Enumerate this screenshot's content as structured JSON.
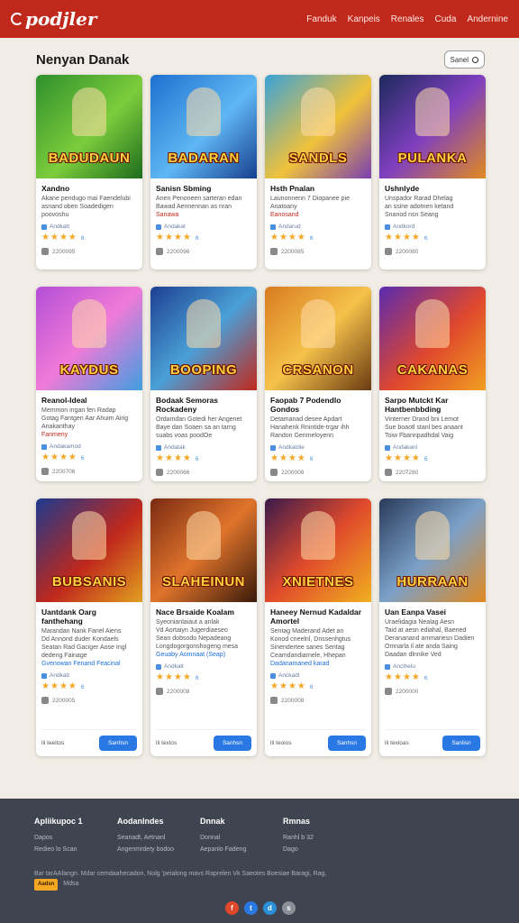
{
  "header": {
    "logo": "podjler",
    "nav": [
      "Fanduk",
      "Kanpeis",
      "Renales",
      "Cuda",
      "Andernine"
    ]
  },
  "section": {
    "title": "Nenyan Danak",
    "search_label": "Sanel"
  },
  "colors": {
    "primary": "#c0281c",
    "button": "#2a78e4",
    "star": "#f5a623",
    "footer": "#3f4550"
  },
  "cards": [
    {
      "art": "BADUDAUN",
      "bg": "linear-gradient(135deg,#2e8f2c,#7ccd3c 55%,#1d6b1d)",
      "title": "Xandno",
      "desc": [
        "Akane pendugo mai Faendelubi",
        "asnand oben Soadedigen",
        "poovoshu"
      ],
      "desc_hl": "",
      "tag": "Andkatt",
      "rating": "6",
      "date": "2200095",
      "fill": 4
    },
    {
      "art": "BADARAN",
      "bg": "linear-gradient(135deg,#1f6fd0,#5fb7f2 55%,#163f8f)",
      "title": "Sanisn Sbming",
      "desc": [
        "Anen Penoneen sarteran edan",
        "Bawad Aennennan as nran"
      ],
      "desc_hl": "Sanawa",
      "tag": "Andakat",
      "rating": "6",
      "date": "2200096",
      "fill": 4
    },
    {
      "art": "SANDLS",
      "bg": "linear-gradient(135deg,#3aa2d8,#f0c23a 55%,#7a3fb0)",
      "title": "Hsth Pnalan",
      "desc": [
        "Launonnenn 7 Diopanee pie",
        "Anatoany"
      ],
      "desc_hl": "Eanosand",
      "tag": "Andarud",
      "rating": "6",
      "date": "2200085",
      "fill": 4
    },
    {
      "art": "PULANKA",
      "bg": "linear-gradient(135deg,#1b2a5a,#7f3fc0 50%,#e08a20)",
      "title": "Ushnlyde",
      "desc": [
        "Unspador Rarad Dhelag",
        "an ssine adotnen ketand",
        "Snanod nsn Seang"
      ],
      "desc_hl": "",
      "tag": "Andkord",
      "rating": "6",
      "date": "2200080",
      "fill": 4
    },
    {
      "art": "KAYDUS",
      "bg": "linear-gradient(135deg,#b34fd8,#f07ad8 50%,#3f9ee0)",
      "title": "Reanol-Ideal",
      "desc": [
        "Memmon ingan fen Radap",
        "Gotag Fantgen Aar Ahuim Airig",
        "Anakanthay"
      ],
      "desc_hl": "Fanmeny",
      "tag": "Andakamod",
      "rating": "6",
      "date": "2200706",
      "fill": 4
    },
    {
      "art": "BOOPING",
      "bg": "linear-gradient(135deg,#1d3f8f,#4aa0d8 50%,#c0281c)",
      "title": "Bodaak Semoras Rockadeny",
      "desc": [
        "Ordamdan Gotedi her Angenet",
        "Baye dan Soaen sa an tarng",
        "suabs voas poodOe"
      ],
      "desc_hl": "",
      "tag": "Andatak",
      "rating": "6",
      "date": "2200066",
      "fill": 4
    },
    {
      "art": "CRSANON",
      "bg": "linear-gradient(135deg,#d87a20,#f5c24a 50%,#6a3a12)",
      "title": "Faopab 7 Podendlo Gondos",
      "desc": [
        "Detamanad desee Apdart",
        "Hanahenk Rnintide-trgar ihh",
        "Randon Genmeloyenn"
      ],
      "desc_hl": "",
      "tag": "Andkatdie",
      "rating": "6",
      "date": "2200008",
      "fill": 4
    },
    {
      "art": "CAKANAS",
      "bg": "linear-gradient(135deg,#5a2bb0,#e0482c 55%,#f0a020)",
      "title": "Sarpo Mutckt Kar Hantbenbbding",
      "desc": [
        "Vinterner Drand bni Lemot",
        "Sue boaotl stanl bes anaant",
        "Toiw Fbannpadhdal Vaig"
      ],
      "desc_hl": "",
      "tag": "Andakani",
      "rating": "6",
      "date": "2207280",
      "fill": 4
    },
    {
      "art": "BUBSANIS",
      "bg": "linear-gradient(135deg,#1d3a8f,#c0281c 55%,#e0a020)",
      "title": "Uantdank Oarg fanthehang",
      "desc": [
        "Marandan Nank Fanel Aiens",
        "Dd Annond duder Kondaels",
        "Seatan Rad Gaciger Aose Ingl",
        "dedeng Fainage"
      ],
      "desc_hl": "Gvenowan Fenand Feacinal",
      "tag": "Andkatt",
      "rating": "6",
      "date": "2200005",
      "fill": 4
    },
    {
      "art": "SLAHEINUN",
      "bg": "linear-gradient(135deg,#7a2a12,#e0742c 50%,#3a1a0a)",
      "title": "Nace Brsaide Koalam",
      "desc": [
        "Syeonianlaiaut a anlak",
        "Vd Aortaiyn Jugerdiaeseo",
        "Sean dobsodo Nepadeang",
        "Longdogorgonshogeng mesa"
      ],
      "desc_hl": "Geuaby Aomnaat (Seap)",
      "tag": "Andkalt",
      "rating": "6",
      "date": "2200008",
      "fill": 4
    },
    {
      "art": "XNIETNES",
      "bg": "linear-gradient(135deg,#3a1a4a,#e04a2c 50%,#f0b020)",
      "title": "Haneey Nernud Kadaldar Amortel",
      "desc": [
        "Sentag Maderand Adet an",
        "Konod cneelnl, Dnssenhgtus",
        "Sinendertee sanes Sentag",
        "Ceamdandiarnele, Hhepan"
      ],
      "desc_hl": "Dadanamaned karad",
      "tag": "Anckadt",
      "rating": "6",
      "date": "2200008",
      "fill": 4
    },
    {
      "art": "HURRAAN",
      "bg": "linear-gradient(135deg,#2a3a5a,#7aa0c8 50%,#e08a20)",
      "title": "Uan Eanpa Vasei",
      "desc": [
        "Uraelidagia Nealag Aesn",
        "Taid at aesn ediahal, Baened",
        "Derananand ammariesn Dadien",
        "Omnarla il ate anda Saing",
        "Daadan dlnnike Ved"
      ],
      "desc_hl": "",
      "tag": "Anclhelu",
      "rating": "6",
      "date": "2200000",
      "fill": 4
    }
  ],
  "row3_footer": {
    "label": "lli texlos",
    "button": "Sanhsn"
  },
  "row3_footer_labels": [
    "lli teeitos",
    "lli texlos",
    "lli teoios",
    "lli texloas"
  ],
  "row3_footer_buttons": [
    "Sanhsn",
    "Sanhsn",
    "Sanhsn",
    "Sanlisn"
  ],
  "footer": {
    "cols": [
      {
        "title": "Apliikupoc 1",
        "items": [
          "Dapos",
          "Redieo lo Scan"
        ]
      },
      {
        "title": "Aodanlndes",
        "items": [
          "Seanadt, Aetnanl",
          "Angenmrdety bodoo"
        ]
      },
      {
        "title": "Dnnak",
        "items": [
          "Donnal",
          "Aepanlo Fadeng"
        ]
      },
      {
        "title": "Rmnas",
        "items": [
          "Ranhl b 32",
          "Dago"
        ]
      }
    ],
    "note": "Bar tarAAfangn. Mdar  cemdaahecadon, Nolg 'peialong mavs Raprelen Vk Saeotes Boesiae Baragi,  Rag,",
    "badge": "Aadsn",
    "badge_text": "Mdsa",
    "social": [
      "f",
      "t",
      "d",
      "s"
    ]
  }
}
